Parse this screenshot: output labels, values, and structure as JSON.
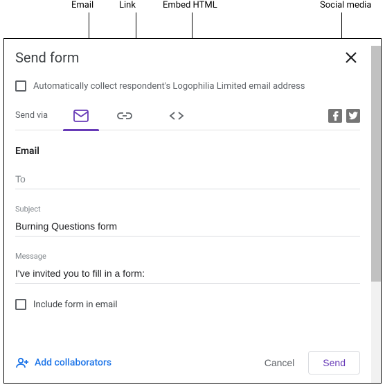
{
  "annotations": {
    "email": "Email",
    "link": "Link",
    "embed": "Embed HTML",
    "social": "Social media"
  },
  "dialog": {
    "title": "Send form",
    "auto_collect_label": "Automatically collect respondent's Logophilia Limited email address",
    "send_via_label": "Send via",
    "section_title": "Email",
    "to_placeholder": "To",
    "subject_label": "Subject",
    "subject_value": "Burning Questions form",
    "message_label": "Message",
    "message_value": "I've invited you to fill in a form:",
    "include_label": "Include form in email",
    "add_collaborators": "Add collaborators",
    "cancel": "Cancel",
    "send": "Send"
  }
}
